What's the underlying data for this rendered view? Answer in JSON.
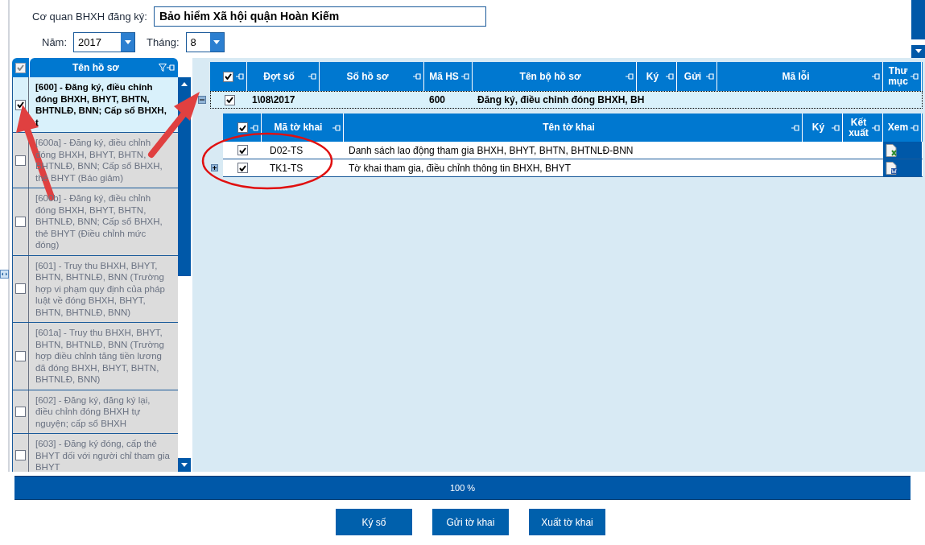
{
  "agency": {
    "label": "Cơ quan BHXH đăng ký:",
    "value": "Bảo hiểm Xã hội quận Hoàn Kiếm"
  },
  "year": {
    "label": "Năm:",
    "value": "2017"
  },
  "month": {
    "label": "Tháng:",
    "value": "8"
  },
  "dossier_list": {
    "header": "Tên hồ sơ",
    "header_checked": true,
    "items": [
      {
        "text": "[600] - Đăng ký, điều chỉnh đóng BHXH, BHYT, BHTN, BHTNLĐ, BNN; Cấp sổ BHXH, t",
        "checked": true,
        "selected": true
      },
      {
        "text": "[600a] - Đăng ký, điều chỉnh đóng BHXH, BHYT, BHTN, BHTNLĐ, BNN; Cấp sổ BHXH, thẻ BHYT (Báo giảm)",
        "checked": false,
        "selected": false
      },
      {
        "text": "[600b] - Đăng ký, điều chỉnh đóng BHXH, BHYT, BHTN, BHTNLĐ, BNN; Cấp sổ BHXH, thẻ BHYT (Điều chỉnh mức đóng)",
        "checked": false,
        "selected": false
      },
      {
        "text": "[601] - Truy thu BHXH, BHYT, BHTN, BHTNLĐ, BNN (Trường hợp vi phạm quy định của pháp luật về đóng BHXH, BHYT, BHTN, BHTNLĐ, BNN)",
        "checked": false,
        "selected": false
      },
      {
        "text": "[601a] - Truy thu BHXH, BHYT, BHTN, BHTNLĐ, BNN (Trường hợp điều chỉnh tăng tiền lương đã đóng BHXH, BHYT, BHTN, BHTNLĐ, BNN)",
        "checked": false,
        "selected": false
      },
      {
        "text": "[602] - Đăng ký, đăng ký lại, điều chỉnh đóng BHXH tự nguyện; cấp sổ BHXH",
        "checked": false,
        "selected": false
      },
      {
        "text": "[603] - Đăng ký đóng, cấp thẻ BHYT đối với người chỉ tham gia BHYT",
        "checked": false,
        "selected": false
      }
    ]
  },
  "batch_table": {
    "header_checked": true,
    "columns": [
      "Đợt số",
      "Số hồ sơ",
      "Mã HS",
      "Tên bộ hồ sơ",
      "Ký",
      "Gửi",
      "Mã lỗi",
      "Thư mục"
    ],
    "rows": [
      {
        "checked": true,
        "expanded": true,
        "cells": [
          "1\\08\\2017",
          "",
          "600",
          "Đăng ký, điều chỉnh đóng BHXH, BH",
          "",
          "",
          "",
          ""
        ]
      }
    ]
  },
  "form_table": {
    "header_checked": true,
    "columns": [
      "Mã tờ khai",
      "Tên tờ khai",
      "Ký",
      "Kết xuất",
      "Xem"
    ],
    "rows": [
      {
        "checked": true,
        "kind": "leaf",
        "code": "D02-TS",
        "name": "Danh sách lao động tham gia BHXH, BHYT, BHTN, BHTNLĐ-BNN",
        "view": {
          "kind": "excel"
        }
      },
      {
        "checked": true,
        "kind": "expandable",
        "code": "TK1-TS",
        "name": "Tờ khai tham gia, điều chỉnh thông tin BHXH, BHYT",
        "view": {
          "kind": "word"
        }
      }
    ]
  },
  "progress": {
    "level": 1,
    "label": "100 %"
  },
  "buttons": [
    "Ký số",
    "Gửi tờ khai",
    "Xuất tờ khai"
  ]
}
